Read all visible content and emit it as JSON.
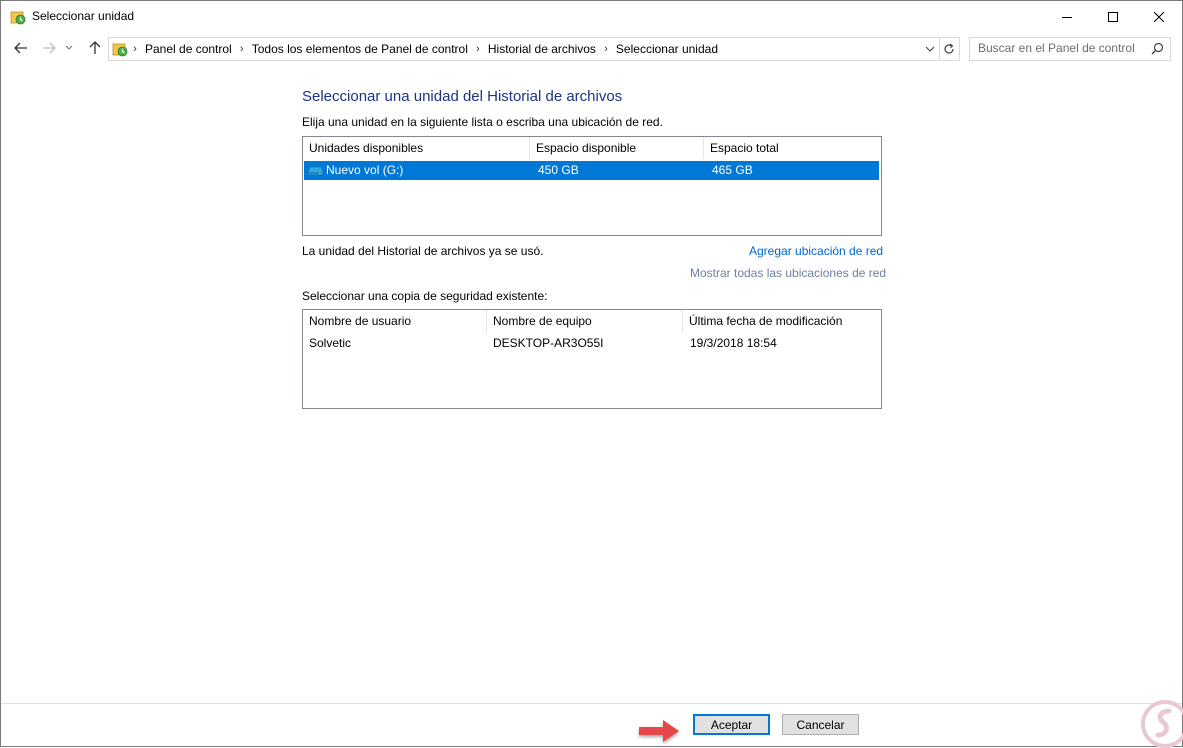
{
  "window": {
    "title": "Seleccionar unidad",
    "title_icon": "file-history-icon",
    "controls": [
      "minimize-icon",
      "maximize-icon",
      "close-icon"
    ]
  },
  "nav": {
    "back": "back-arrow-icon",
    "forward": "forward-arrow-icon",
    "recent": "chevron-down-icon",
    "up": "up-arrow-icon",
    "breadcrumbs": [
      "Panel de control",
      "Todos los elementos de Panel de control",
      "Historial de archivos",
      "Seleccionar unidad"
    ],
    "search_placeholder": "Buscar en el Panel de control"
  },
  "content": {
    "heading": "Seleccionar una unidad del Historial de archivos",
    "subtext": "Elija una unidad en la siguiente lista o escriba una ubicación de red.",
    "drives": {
      "columns": [
        "Unidades disponibles",
        "Espacio disponible",
        "Espacio total"
      ],
      "rows": [
        {
          "name": "Nuevo vol (G:)",
          "free": "450 GB",
          "total": "465 GB",
          "selected": true
        }
      ]
    },
    "used_info": "La unidad del Historial de archivos ya se usó.",
    "add_network_link": "Agregar ubicación de red",
    "show_network_link": "Mostrar todas las ubicaciones de red",
    "backup_label": "Seleccionar una copia de seguridad existente:",
    "backups": {
      "columns": [
        "Nombre de usuario",
        "Nombre de equipo",
        "Última fecha de modificación"
      ],
      "rows": [
        {
          "user": "Solvetic",
          "computer": "DESKTOP-AR3O55I",
          "modified": "19/3/2018 18:54"
        }
      ]
    }
  },
  "footer": {
    "ok_label": "Aceptar",
    "cancel_label": "Cancelar"
  },
  "colors": {
    "heading": "#1e3287",
    "selection": "#0078d7",
    "link": "#0066cc",
    "arrow": "#e8474a"
  }
}
